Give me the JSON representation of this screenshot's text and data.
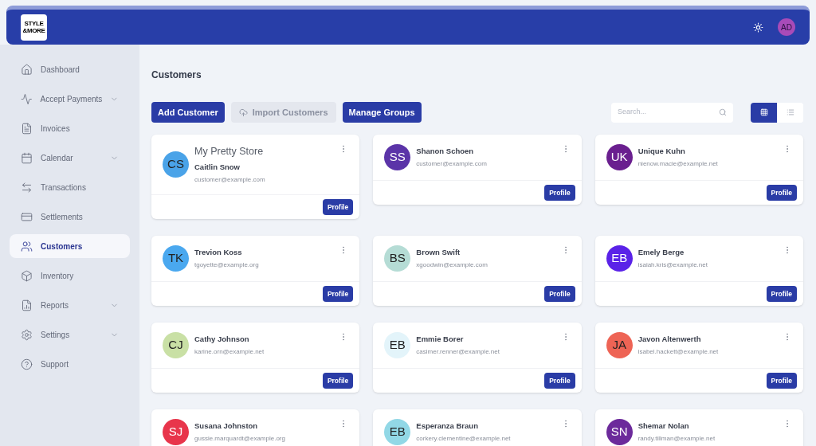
{
  "logo": {
    "lines": [
      "STYLE",
      "&MORE"
    ]
  },
  "header": {
    "user_initials": "AD"
  },
  "sidebar": {
    "items": [
      {
        "label": "Dashboard",
        "selected": false
      },
      {
        "label": "Accept Payments",
        "selected": false,
        "expanded": false
      },
      {
        "label": "Invoices",
        "selected": false
      },
      {
        "label": "Calendar",
        "selected": false,
        "expanded": false
      },
      {
        "label": "Transactions",
        "selected": false
      },
      {
        "label": "Settlements",
        "selected": false
      },
      {
        "label": "Customers",
        "selected": true
      },
      {
        "label": "Inventory",
        "selected": false
      },
      {
        "label": "Reports",
        "selected": false,
        "expanded": false
      },
      {
        "label": "Settings",
        "selected": false,
        "expanded": false
      },
      {
        "label": "Support",
        "selected": false
      }
    ]
  },
  "page_title": "Customers",
  "toolbar": {
    "buttons": [
      {
        "label": "Add Customer",
        "kind": "primary"
      },
      {
        "label": "Import Customers",
        "kind": "import"
      },
      {
        "label": "Manage Groups",
        "kind": "primary"
      }
    ],
    "search": {
      "placeholder": "Search..."
    },
    "views": [
      {
        "kind": "grid",
        "selected": true
      },
      {
        "kind": "list",
        "selected": false
      }
    ]
  },
  "customers": [
    {
      "initials": "CS",
      "color": "#4aa3e8",
      "store": "My Pretty Store",
      "name": "Caitlin Snow",
      "email": "customer@example.com",
      "button": "Profile"
    },
    {
      "initials": "SS",
      "color": "#5b34a8",
      "name": "Shanon Schoen",
      "email": "customer@example.com",
      "button": "Profile"
    },
    {
      "initials": "UK",
      "color": "#6a1f8f",
      "name": "Unique Kuhn",
      "email": "nienow.macie@example.net",
      "button": "Profile"
    },
    {
      "initials": "TK",
      "color": "#4aa8ef",
      "name": "Trevion Koss",
      "email": "tgoyette@example.org",
      "button": "Profile"
    },
    {
      "initials": "BS",
      "color": "#b5dcd5",
      "name": "Brown Swift",
      "email": "xgoodwin@example.com",
      "button": "Profile"
    },
    {
      "initials": "EB",
      "color": "#5a22e8",
      "name": "Emely Berge",
      "email": "isaiah.kris@example.net",
      "button": "Profile"
    },
    {
      "initials": "CJ",
      "color": "#c9e0a5",
      "name": "Cathy Johnson",
      "email": "karine.orn@example.net",
      "button": "Profile"
    },
    {
      "initials": "EB",
      "color": "#e3f4fa",
      "name": "Emmie Borer",
      "email": "casimer.renner@example.net",
      "button": "Profile"
    },
    {
      "initials": "JA",
      "color": "#ee6455",
      "name": "Javon Altenwerth",
      "email": "isabel.hackett@example.net",
      "button": "Profile"
    },
    {
      "initials": "SJ",
      "color": "#e8354b",
      "name": "Susana Johnston",
      "email": "gussie.marquardt@example.org"
    },
    {
      "initials": "EB",
      "color": "#92d8e6",
      "name": "Esperanza Braun",
      "email": "corkery.clementine@example.net"
    },
    {
      "initials": "SN",
      "color": "#6c2a9b",
      "name": "Shemar Nolan",
      "email": "randy.tillman@example.net"
    }
  ]
}
